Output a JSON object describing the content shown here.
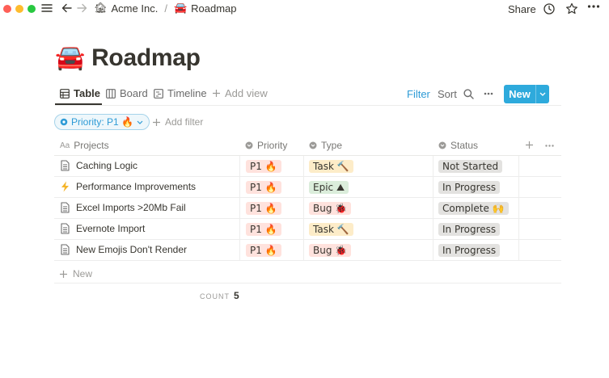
{
  "window": {
    "breadcrumbs": [
      {
        "emoji": "🏚",
        "label": "Acme Inc."
      },
      {
        "emoji": "🚘",
        "label": "Roadmap"
      }
    ],
    "separator": "/",
    "share_label": "Share"
  },
  "page": {
    "emoji": "🚘",
    "title": "Roadmap"
  },
  "views": {
    "tabs": [
      {
        "label": "Table",
        "active": true
      },
      {
        "label": "Board",
        "active": false
      },
      {
        "label": "Timeline",
        "active": false
      }
    ],
    "add_view_label": "Add view",
    "filter_label": "Filter",
    "sort_label": "Sort",
    "new_label": "New"
  },
  "filters": {
    "active_chip": "Priority: P1 🔥",
    "add_filter_label": "Add filter"
  },
  "table": {
    "columns": {
      "projects": "Projects",
      "priority": "Priority",
      "type": "Type",
      "status": "Status"
    },
    "rows": [
      {
        "icon": "page",
        "name": "Caching Logic",
        "priority": "P1 🔥",
        "type": "Task 🔨",
        "type_kind": "task",
        "status": "Not Started"
      },
      {
        "icon": "lightning",
        "name": "Performance Improvements",
        "priority": "P1 🔥",
        "type": "Epic ⛰",
        "type_kind": "epic",
        "status": "In Progress"
      },
      {
        "icon": "page",
        "name": "Excel Imports >20Mb Fail",
        "priority": "P1 🔥",
        "type": "Bug 🐞",
        "type_kind": "bug",
        "status": "Complete 🙌"
      },
      {
        "icon": "page",
        "name": "Evernote Import",
        "priority": "P1 🔥",
        "type": "Task 🔨",
        "type_kind": "task",
        "status": "In Progress"
      },
      {
        "icon": "page",
        "name": "New Emojis Don't Render",
        "priority": "P1 🔥",
        "type": "Bug 🐞",
        "type_kind": "bug",
        "status": "In Progress"
      }
    ],
    "new_row_label": "New",
    "count_label": "COUNT",
    "count_value": "5"
  },
  "colors": {
    "accent": "#2eaadc",
    "filter_blue": "#2e9bd6",
    "tag_red": "#ffe2dd",
    "tag_yellow": "#fdecc8",
    "tag_green": "#dbeddb",
    "tag_gray": "#e3e2e0"
  }
}
